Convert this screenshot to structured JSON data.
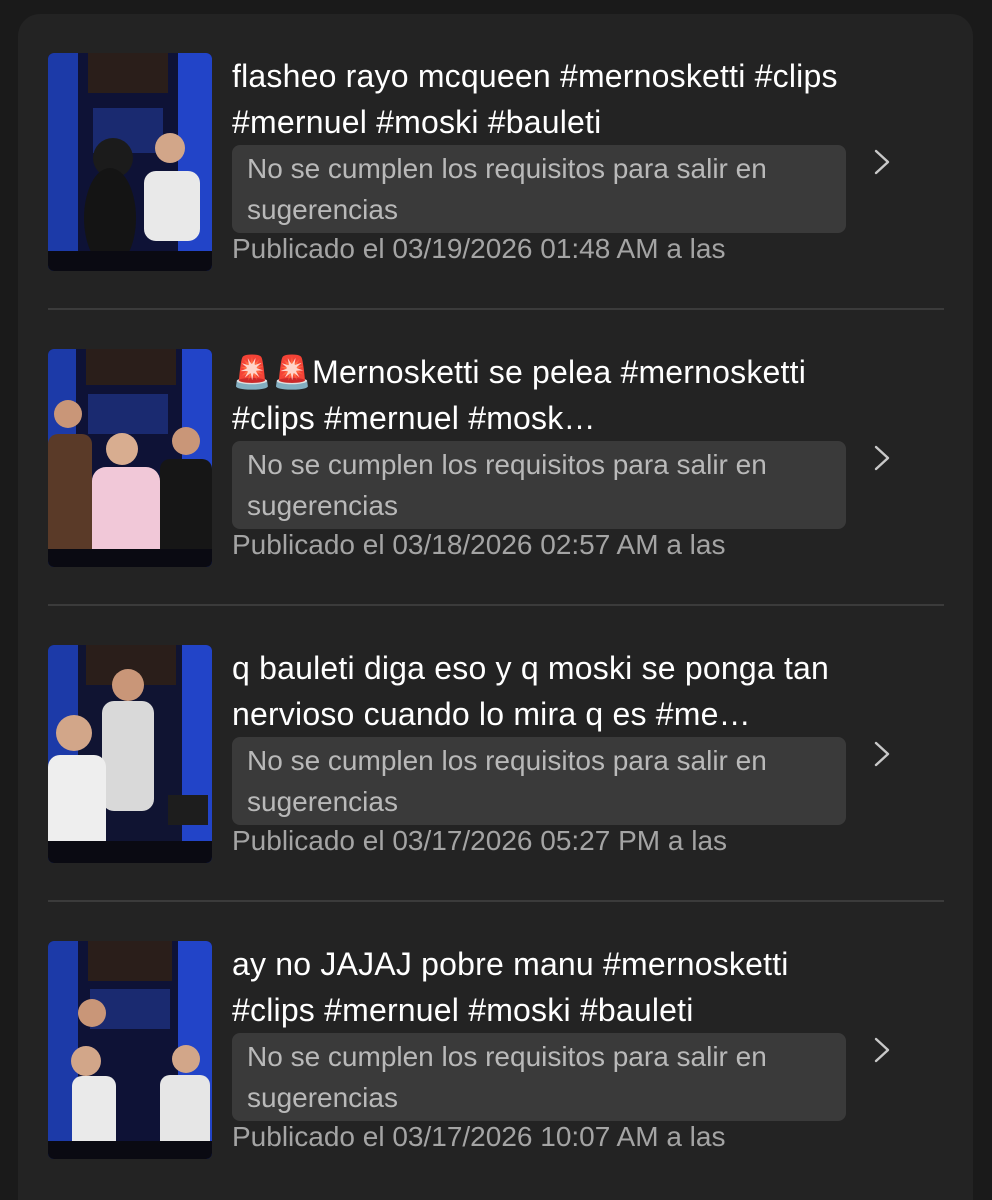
{
  "items": [
    {
      "title": "flasheo rayo mcqueen #mernosketti #clips #mernuel #moski #bauleti",
      "notice": "No se cumplen los requisitos para salir en sugerencias",
      "date": "Publicado el 03/19/2026 01:48 AM a las"
    },
    {
      "title": "🚨🚨Mernosketti se pelea #mernosketti #clips #mernuel #mosk…",
      "notice": "No se cumplen los requisitos para salir en sugerencias",
      "date": "Publicado el 03/18/2026 02:57 AM a las"
    },
    {
      "title": "q bauleti diga eso y q moski se ponga tan nervioso cuando lo mira q es #me…",
      "notice": "No se cumplen los requisitos para salir en sugerencias",
      "date": "Publicado el 03/17/2026 05:27 PM a las"
    },
    {
      "title": "ay no JAJAJ pobre manu #mernosketti #clips #mernuel #moski #bauleti",
      "notice": "No se cumplen los requisitos para salir en sugerencias",
      "date": "Publicado el 03/17/2026 10:07 AM a las"
    }
  ],
  "icons": {
    "row_action": "chevron-right-icon"
  },
  "colors": {
    "background": "#1a1a1a",
    "panel": "#232323",
    "notice_bg": "#3a3a3a",
    "title_text": "#ffffff",
    "secondary_text": "#a4a4a4"
  }
}
